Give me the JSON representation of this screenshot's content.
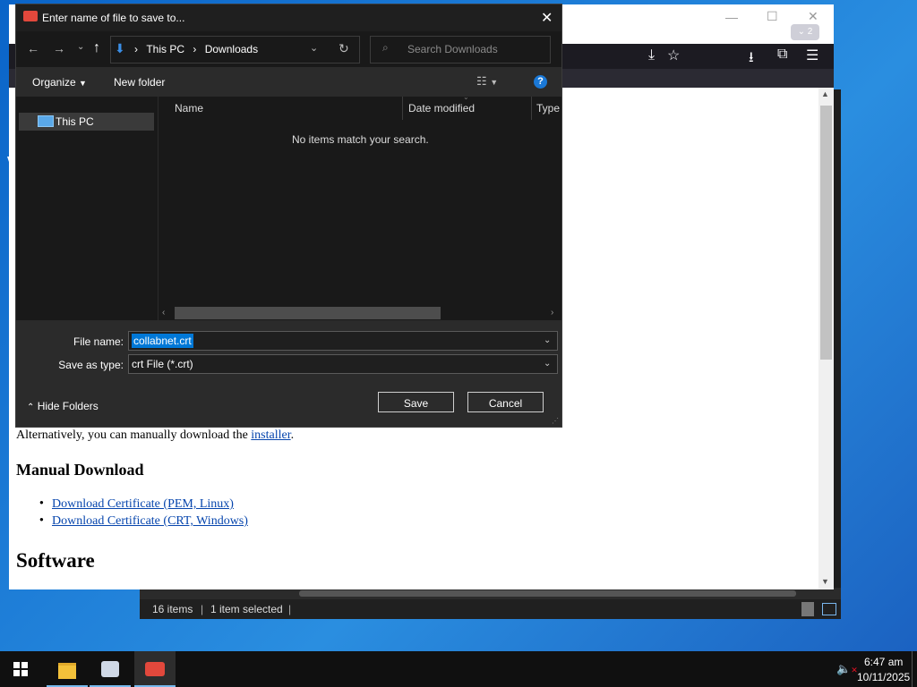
{
  "dialog": {
    "title": "Enter name of file to save to...",
    "close_glyph": "✕",
    "breadcrumb": [
      "This PC",
      "Downloads"
    ],
    "breadcrumb_sep": "›",
    "search_placeholder": "Search Downloads",
    "organize_label": "Organize",
    "new_folder_label": "New folder",
    "nav_item": "This PC",
    "columns": [
      "Name",
      "Date modified",
      "Type"
    ],
    "empty_message": "No items match your search.",
    "file_name_label": "File name:",
    "file_name_value": "collabnet.crt",
    "save_type_label": "Save as type:",
    "save_type_value": "crt File (*.crt)",
    "hide_folders_label": "Hide Folders",
    "save_label": "Save",
    "cancel_label": "Cancel"
  },
  "browser": {
    "download_badge": "2",
    "page": {
      "alt_text_before": "Alternatively, you can manually download the ",
      "alt_link": "installer",
      "alt_text_after": ".",
      "manual_heading": "Manual Download",
      "cert_links": [
        "Download Certificate (PEM, Linux)",
        "Download Certificate (CRT, Windows)"
      ],
      "software_heading": "Software"
    }
  },
  "explorer": {
    "status_items": "16 items",
    "status_selected": "1 item selected"
  },
  "taskbar": {
    "time": "6:47 am",
    "date": "10/11/2025",
    "apps": [
      "start-icon",
      "file-explorer-icon",
      "control-panel-icon",
      "browser-icon"
    ]
  },
  "colors": {
    "selection": "#0078d7",
    "link": "#0645ad",
    "help": "#1a78d6"
  }
}
